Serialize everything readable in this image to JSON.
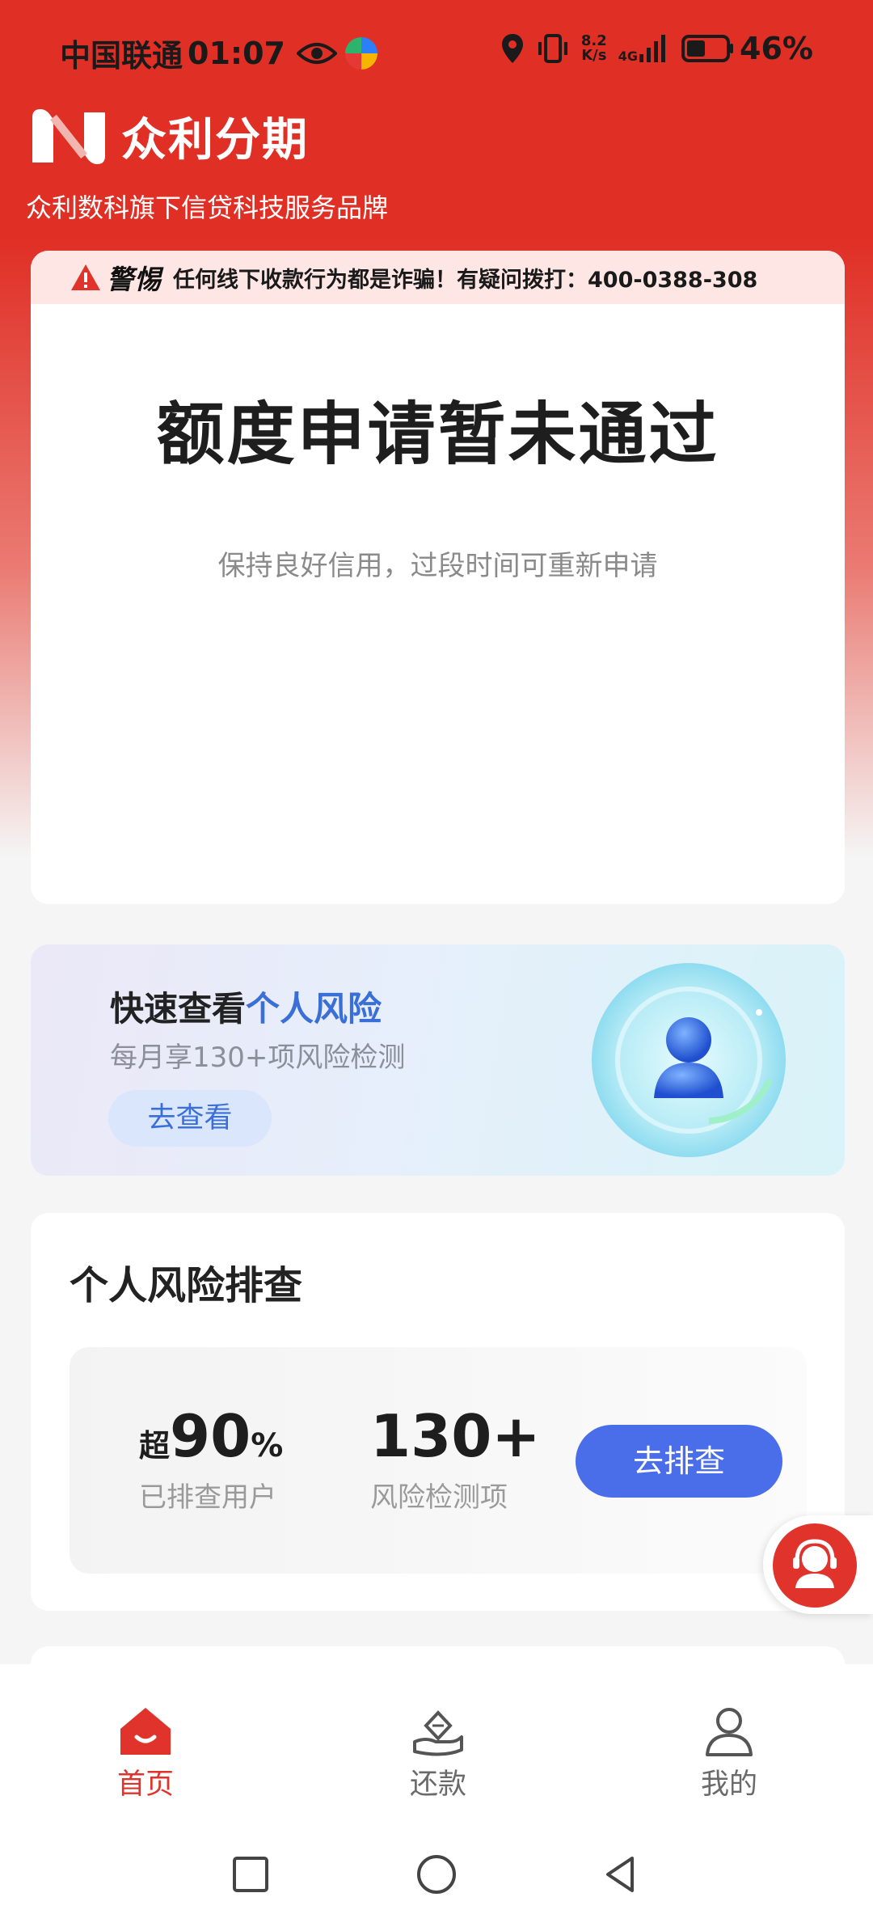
{
  "status_bar": {
    "carrier": "中国联通",
    "time": "01:07",
    "speed_value": "8.2",
    "speed_unit": "K/s",
    "network": "4G",
    "battery": "46%"
  },
  "brand": {
    "name": "众利分期",
    "tagline": "众利数科旗下信贷科技服务品牌"
  },
  "warning": {
    "tag": "警惕",
    "text": "任何线下收款行为都是诈骗！有疑问拨打：400-0388-308"
  },
  "application_status": {
    "title": "额度申请暂未通过",
    "subtitle": "保持良好信用，过段时间可重新申请"
  },
  "risk_banner": {
    "title_prefix": "快速查看",
    "title_highlight": "个人风险",
    "subtitle": "每月享130+项风险检测",
    "button": "去查看"
  },
  "risk_check": {
    "title": "个人风险排查",
    "stat1_prefix": "超",
    "stat1_value": "90",
    "stat1_unit": "%",
    "stat1_label": "已排查用户",
    "stat2_value": "130+",
    "stat2_label": "风险检测项",
    "button": "去排查"
  },
  "bottom_nav": {
    "home": "首页",
    "repay": "还款",
    "mine": "我的"
  },
  "colors": {
    "brand_red": "#e0332b",
    "accent_blue": "#4a6ee9"
  }
}
